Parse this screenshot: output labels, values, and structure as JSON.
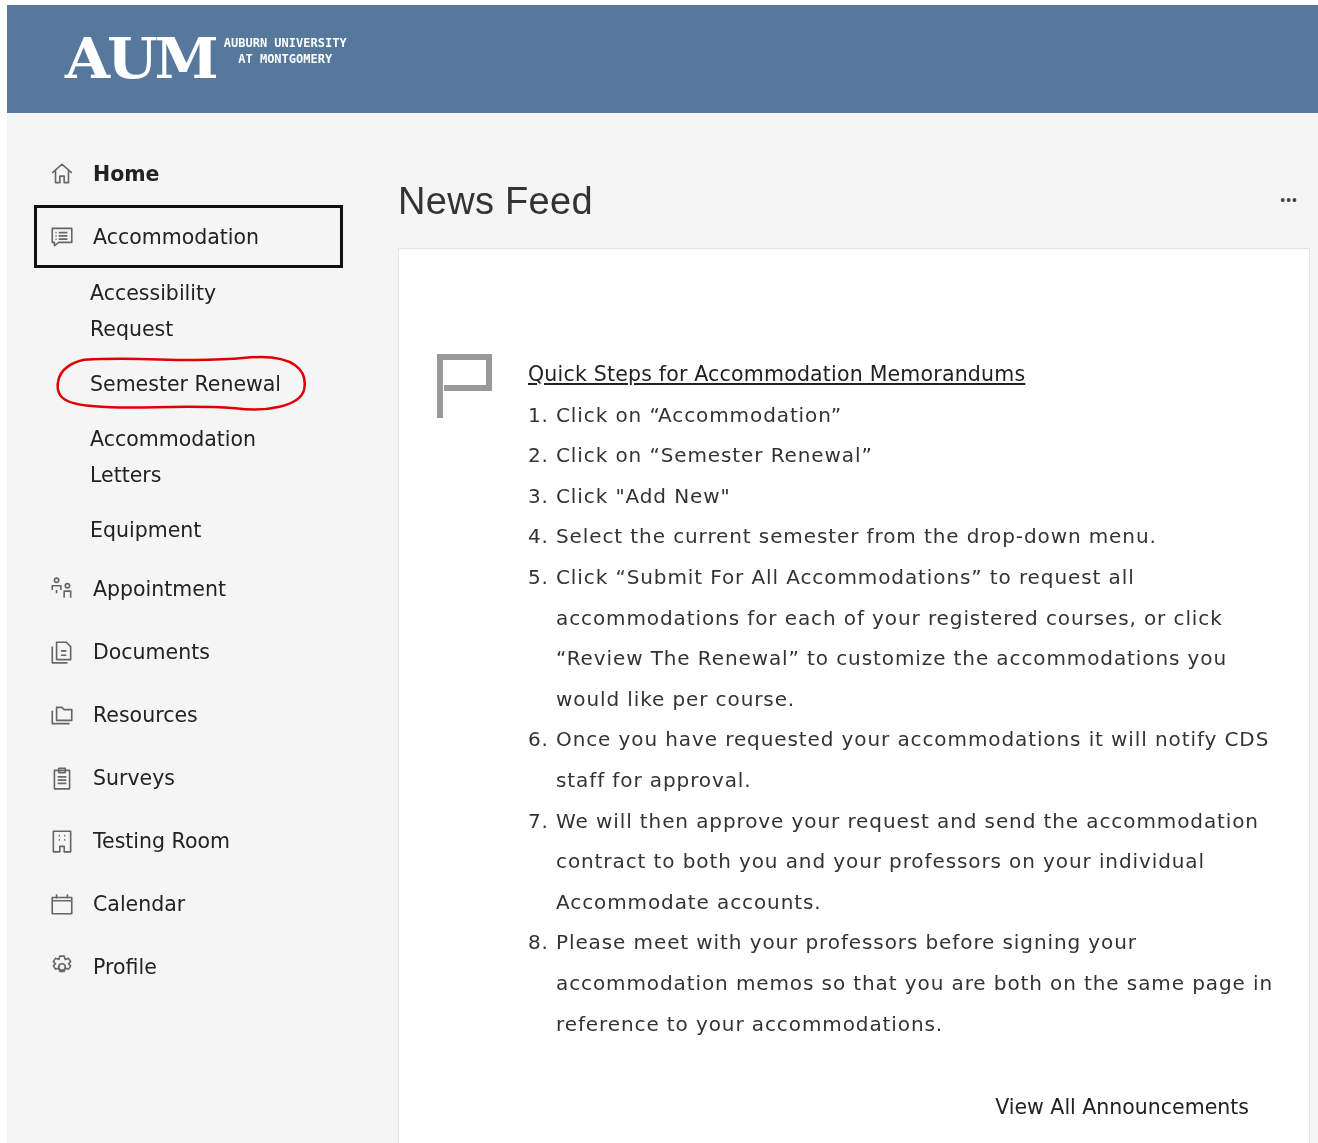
{
  "header": {
    "logo": {
      "mark": "AUM",
      "line_1": "AUBURN UNIVERSITY",
      "line_2": "AT MONTGOMERY"
    }
  },
  "sidebar": {
    "items": [
      {
        "label": "Home",
        "selected": false
      },
      {
        "label": "Accommodation",
        "selected": true,
        "children": [
          {
            "label": "Accessibility Request",
            "circled": false
          },
          {
            "label": "Semester Renewal",
            "circled": true
          },
          {
            "label": "Accommodation Letters",
            "circled": false
          },
          {
            "label": "Equipment",
            "circled": false
          }
        ]
      },
      {
        "label": "Appointment",
        "selected": false
      },
      {
        "label": "Documents",
        "selected": false
      },
      {
        "label": "Resources",
        "selected": false
      },
      {
        "label": "Surveys",
        "selected": false
      },
      {
        "label": "Testing Room",
        "selected": false
      },
      {
        "label": "Calendar",
        "selected": false
      },
      {
        "label": "Profile",
        "selected": false
      }
    ]
  },
  "news_feed": {
    "title": "News Feed",
    "more": "•••",
    "announcement": {
      "heading": "Quick Steps for Accommodation Memorandums",
      "steps": [
        {
          "number": "1.",
          "text": "Click on “Accommodation”"
        },
        {
          "number": "2.",
          "text": "Click on “Semester Renewal”"
        },
        {
          "number": "3.",
          "text": "Click \"Add New\""
        },
        {
          "number": "4.",
          "text": "Select the current semester from the drop-down menu."
        },
        {
          "number": "5.",
          "text": "Click “Submit For All Accommodations” to request all accommodations for each of your registered courses, or click “Review The Renewal” to customize the accommodations you would like per course."
        },
        {
          "number": "6.",
          "text": "Once you have requested your accommodations it will notify CDS staff for approval."
        },
        {
          "number": "7.",
          "text": "We will then approve your request and send the accommodation contract to both you and your professors on your individual Accommodate accounts."
        },
        {
          "number": "8.",
          "text": "Please meet with your professors before signing your accommodation memos so that you are both on the same page in reference to your accommodations."
        }
      ]
    },
    "view_all": "View All Announcements"
  }
}
